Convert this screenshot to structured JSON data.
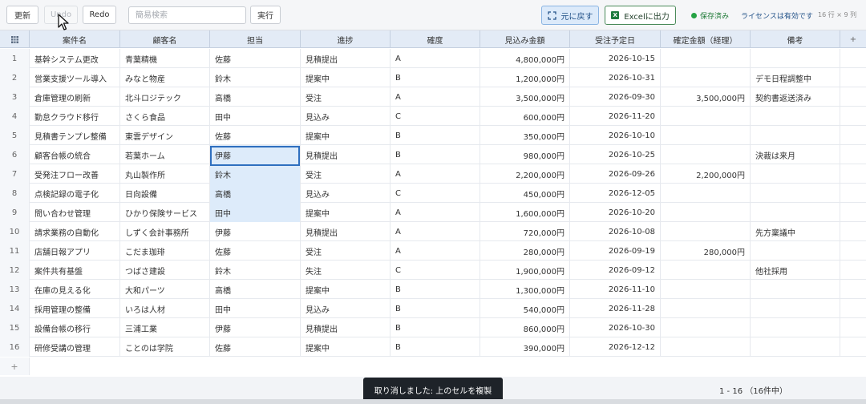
{
  "toolbar": {
    "refresh": "更新",
    "undo": "Undo",
    "redo": "Redo",
    "search_placeholder": "簡易検索",
    "execute": "実行",
    "restore": "元に戻す",
    "excel": "Excelに出力",
    "saved": "保存済み",
    "license": "ライセンスは有効です",
    "dims": "16 行 × 9 列"
  },
  "columns": [
    "案件名",
    "顧客名",
    "担当",
    "進捗",
    "確度",
    "見込み金額",
    "受注予定日",
    "確定金額（経理）",
    "備考"
  ],
  "add_column": "+",
  "add_row": "+",
  "rows": [
    {
      "no": "1",
      "cells": [
        "基幹システム更改",
        "青葉精機",
        "佐藤",
        "見積提出",
        "A",
        "4,800,000円",
        "2026-10-15",
        "",
        ""
      ]
    },
    {
      "no": "2",
      "cells": [
        "営業支援ツール導入",
        "みなと物産",
        "鈴木",
        "提案中",
        "B",
        "1,200,000円",
        "2026-10-31",
        "",
        "デモ日程調整中"
      ]
    },
    {
      "no": "3",
      "cells": [
        "倉庫管理の刷新",
        "北斗ロジテック",
        "高橋",
        "受注",
        "A",
        "3,500,000円",
        "2026-09-30",
        "3,500,000円",
        "契約書返送済み"
      ]
    },
    {
      "no": "4",
      "cells": [
        "勤怠クラウド移行",
        "さくら食品",
        "田中",
        "見込み",
        "C",
        "600,000円",
        "2026-11-20",
        "",
        ""
      ]
    },
    {
      "no": "5",
      "cells": [
        "見積書テンプレ整備",
        "東雲デザイン",
        "佐藤",
        "提案中",
        "B",
        "350,000円",
        "2026-10-10",
        "",
        ""
      ]
    },
    {
      "no": "6",
      "cells": [
        "顧客台帳の統合",
        "若葉ホーム",
        "伊藤",
        "見積提出",
        "B",
        "980,000円",
        "2026-10-25",
        "",
        "決裁は来月"
      ]
    },
    {
      "no": "7",
      "cells": [
        "受発注フロー改善",
        "丸山製作所",
        "鈴木",
        "受注",
        "A",
        "2,200,000円",
        "2026-09-26",
        "2,200,000円",
        ""
      ]
    },
    {
      "no": "8",
      "cells": [
        "点検記録の電子化",
        "日向設備",
        "高橋",
        "見込み",
        "C",
        "450,000円",
        "2026-12-05",
        "",
        ""
      ]
    },
    {
      "no": "9",
      "cells": [
        "問い合わせ管理",
        "ひかり保険サービス",
        "田中",
        "提案中",
        "A",
        "1,600,000円",
        "2026-10-20",
        "",
        ""
      ]
    },
    {
      "no": "10",
      "cells": [
        "請求業務の自動化",
        "しずく会計事務所",
        "伊藤",
        "見積提出",
        "A",
        "720,000円",
        "2026-10-08",
        "",
        "先方稟議中"
      ]
    },
    {
      "no": "11",
      "cells": [
        "店舗日報アプリ",
        "こだま珈琲",
        "佐藤",
        "受注",
        "A",
        "280,000円",
        "2026-09-19",
        "280,000円",
        ""
      ]
    },
    {
      "no": "12",
      "cells": [
        "案件共有基盤",
        "つばさ建設",
        "鈴木",
        "失注",
        "C",
        "1,900,000円",
        "2026-09-12",
        "",
        "他社採用"
      ]
    },
    {
      "no": "13",
      "cells": [
        "在庫の見える化",
        "大和パーツ",
        "高橋",
        "提案中",
        "B",
        "1,300,000円",
        "2026-11-10",
        "",
        ""
      ]
    },
    {
      "no": "14",
      "cells": [
        "採用管理の整備",
        "いろは人材",
        "田中",
        "見込み",
        "B",
        "540,000円",
        "2026-11-28",
        "",
        ""
      ]
    },
    {
      "no": "15",
      "cells": [
        "設備台帳の移行",
        "三浦工業",
        "伊藤",
        "見積提出",
        "B",
        "860,000円",
        "2026-10-30",
        "",
        ""
      ]
    },
    {
      "no": "16",
      "cells": [
        "研修受講の管理",
        "ことのは学院",
        "佐藤",
        "提案中",
        "B",
        "390,000円",
        "2026-12-12",
        "",
        ""
      ]
    }
  ],
  "toast": "取り消しました: 上のセルを複製",
  "pager": "1 - 16 （16件中）",
  "colors": {
    "accent": "#2f6fbf",
    "header_bg": "#e3ebf6",
    "selection": "#ddebfa",
    "saved": "#25a244",
    "license": "#1f4f86"
  }
}
